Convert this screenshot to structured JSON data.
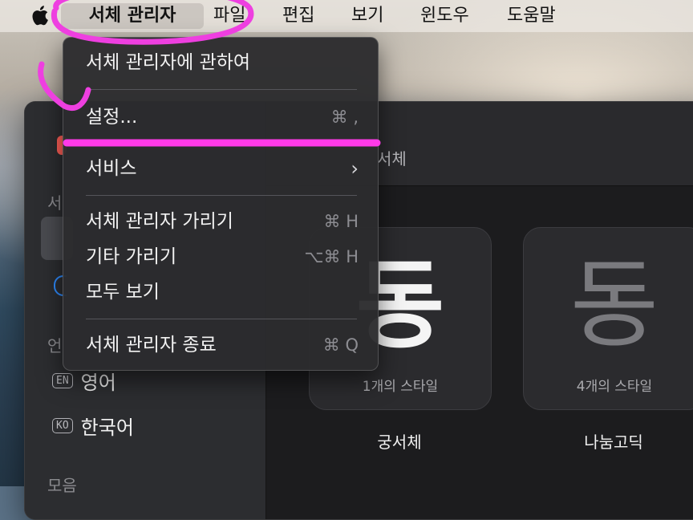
{
  "menubar": {
    "app_name": "서체 관리자",
    "items": [
      "파일",
      "편집",
      "보기",
      "윈도우",
      "도움말"
    ]
  },
  "app_menu": {
    "about": "서체 관리자에 관하여",
    "settings": "설정...",
    "settings_shortcut": "⌘ ,",
    "services": "서비스",
    "services_chevron": "›",
    "hide": "서체 관리자 가리기",
    "hide_shortcut": "⌘ H",
    "hide_others": "기타 가리기",
    "hide_others_shortcut": "⌥⌘ H",
    "show_all": "모두 보기",
    "quit": "서체 관리자 종료",
    "quit_shortcut": "⌘ Q"
  },
  "sidebar": {
    "section_partial": "서",
    "language_section_partial": "언",
    "collections_partial": "모음",
    "languages": [
      {
        "badge": "EN",
        "label": "영어"
      },
      {
        "badge": "KO",
        "label": "한국어"
      }
    ]
  },
  "toolbar": {
    "title_partial": "서체"
  },
  "fonts": [
    {
      "glyph": "동",
      "styles": "1개의 스타일",
      "name": "궁서체"
    },
    {
      "glyph": "동",
      "styles": "4개의 스타일",
      "name": "나눔고딕"
    }
  ],
  "annotation_colors": {
    "circle": "#ee3fe0",
    "underline": "#ff3ae8"
  }
}
